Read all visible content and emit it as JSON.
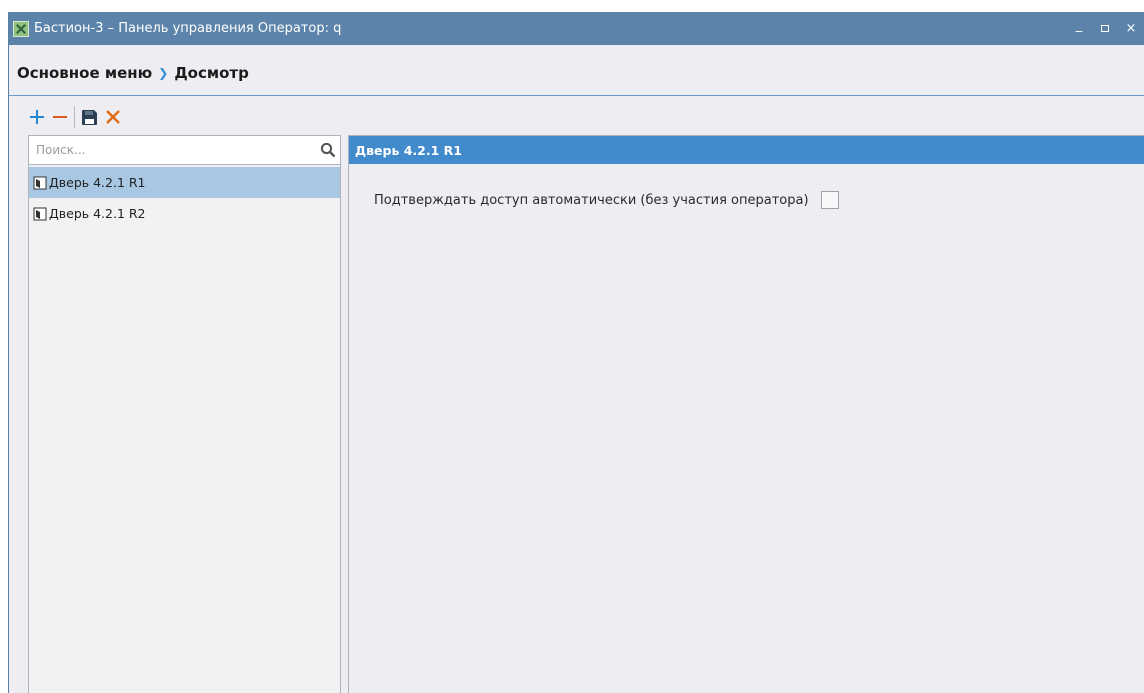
{
  "window": {
    "title": "Бастион-3 – Панель управления Оператор: q",
    "controls": {
      "minimize": "_",
      "close": "×"
    }
  },
  "breadcrumb": {
    "root": "Основное меню",
    "current": "Досмотр"
  },
  "toolbar": {
    "buttons": [
      {
        "icon": "plus-icon",
        "color": "#1f87d6"
      },
      {
        "icon": "minus-icon",
        "color": "#e05a1f"
      },
      {
        "icon": "save-icon",
        "color": "#2a3f52"
      },
      {
        "icon": "close-icon",
        "color": "#e06a12"
      }
    ]
  },
  "search": {
    "placeholder": "Поиск...",
    "value": ""
  },
  "list": {
    "items": [
      {
        "label": "Дверь 4.2.1 R1",
        "selected": true
      },
      {
        "label": "Дверь 4.2.1 R2",
        "selected": false
      }
    ]
  },
  "detail": {
    "header": "Дверь 4.2.1 R1",
    "option_label": "Подтверждать доступ автоматически (без участия оператора)",
    "option_checked": false
  },
  "colors": {
    "titlebar": "#5c84ab",
    "header_accent": "#418bcc",
    "selection": "#a8c7e2"
  }
}
